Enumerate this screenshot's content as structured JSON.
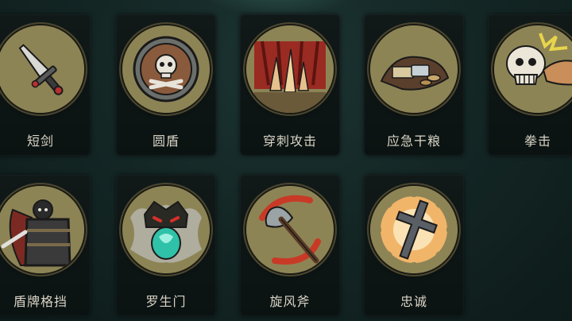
{
  "skills": [
    {
      "label": "短剑",
      "icon": "short-sword-icon"
    },
    {
      "label": "圆盾",
      "icon": "round-shield-icon"
    },
    {
      "label": "穿刺攻击",
      "icon": "pierce-attack-icon"
    },
    {
      "label": "应急干粮",
      "icon": "emergency-rations-icon"
    },
    {
      "label": "拳击",
      "icon": "punch-icon"
    },
    {
      "label": "盾牌格挡",
      "icon": "shield-block-icon"
    },
    {
      "label": "罗生门",
      "icon": "rashomon-icon"
    },
    {
      "label": "旋风斧",
      "icon": "whirlwind-axe-icon"
    },
    {
      "label": "忠诚",
      "icon": "loyalty-icon"
    }
  ],
  "colors": {
    "background": "#142725",
    "card": "#0e1716",
    "medal": "#8d8456",
    "label": "#d9d4c6"
  }
}
